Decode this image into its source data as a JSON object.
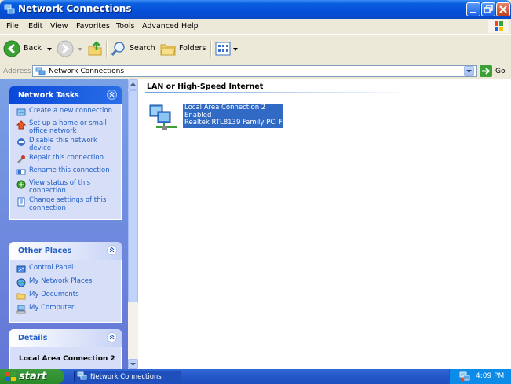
{
  "window": {
    "title": "Network Connections",
    "icon": "network-connections-icon",
    "title_color": "#0550d8"
  },
  "menu": {
    "items": [
      "File",
      "Edit",
      "View",
      "Favorites",
      "Tools",
      "Advanced",
      "Help"
    ]
  },
  "toolbar": {
    "back_label": "Back",
    "search_label": "Search",
    "folders_label": "Folders"
  },
  "address": {
    "label": "Address",
    "value": "Network Connections",
    "go_label": "Go"
  },
  "sidebar": {
    "network_tasks": {
      "title": "Network Tasks",
      "items": [
        {
          "label": "Create a new connection",
          "icon": "new-connection-icon"
        },
        {
          "label": "Set up a home or small office network",
          "icon": "home-network-icon"
        },
        {
          "label": "Disable this network device",
          "icon": "disable-device-icon"
        },
        {
          "label": "Repair this connection",
          "icon": "repair-icon"
        },
        {
          "label": "Rename this connection",
          "icon": "rename-icon"
        },
        {
          "label": "View status of this connection",
          "icon": "status-icon"
        },
        {
          "label": "Change settings of this connection",
          "icon": "settings-icon"
        }
      ]
    },
    "other_places": {
      "title": "Other Places",
      "items": [
        {
          "label": "Control Panel",
          "icon": "control-panel-icon"
        },
        {
          "label": "My Network Places",
          "icon": "network-places-icon"
        },
        {
          "label": "My Documents",
          "icon": "documents-folder-icon"
        },
        {
          "label": "My Computer",
          "icon": "computer-icon"
        }
      ]
    },
    "details": {
      "title": "Details",
      "item_title": "Local Area Connection 2"
    }
  },
  "content": {
    "group_header": "LAN or High-Speed Internet",
    "connection": {
      "name": "Local Area Connection 2",
      "status": "Enabled",
      "device": "Realtek RTL8139 Family PCI F..."
    }
  },
  "taskbar": {
    "start_label": "start",
    "window_button": "Network Connections",
    "clock": "4:09 PM"
  }
}
